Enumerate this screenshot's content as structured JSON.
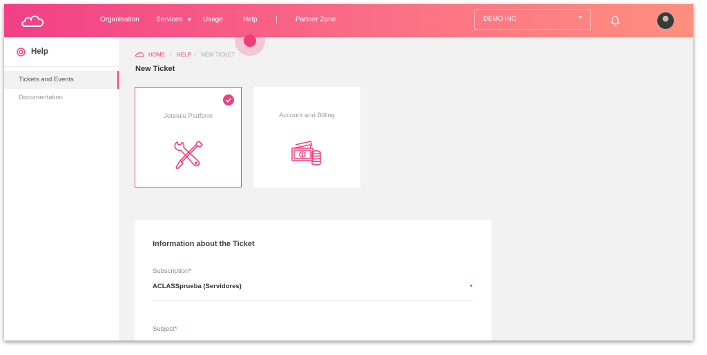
{
  "nav": {
    "items": [
      {
        "label": "Organisation"
      },
      {
        "label": "Services"
      },
      {
        "label": "Usage"
      },
      {
        "label": "Help"
      },
      {
        "label": "Partner Zone"
      }
    ],
    "separator": "|",
    "services_caret": "▼"
  },
  "org_select": {
    "value": "DEMO INC",
    "caret": "▼"
  },
  "sidebar": {
    "title": "Help",
    "items": [
      {
        "label": "Tickets and Events",
        "active": true
      },
      {
        "label": "Documentation",
        "active": false
      }
    ]
  },
  "breadcrumb": {
    "items": [
      "HOME",
      "HELP",
      "NEW TICKET"
    ],
    "separator": "/"
  },
  "page_title": "New Ticket",
  "cards": [
    {
      "label": "Jotelulu Platform",
      "selected": true,
      "icon": "tools-icon"
    },
    {
      "label": "Account and Billing",
      "selected": false,
      "icon": "money-icon"
    }
  ],
  "form": {
    "title": "Information about the Ticket",
    "subscription_label": "Subscription",
    "subscription_value": "ACLASSprueba (Servidores)",
    "subject_label": "Subject",
    "required_mark": "*",
    "select_caret": "▼"
  },
  "colors": {
    "accent": "#f0407e",
    "topbar_start": "#f23f86",
    "topbar_end": "#ff8f7e"
  }
}
